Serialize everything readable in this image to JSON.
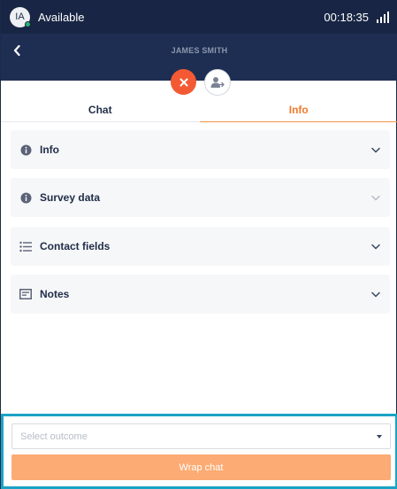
{
  "status_bar": {
    "avatar_initials": "IA",
    "presence_color": "#2ab36a",
    "status_label": "Available",
    "timer": "00:18:35"
  },
  "header": {
    "contact_name": "JAMES SMITH",
    "back_icon": "chevron-left-icon",
    "end_icon": "close-icon",
    "transfer_icon": "transfer-user-icon"
  },
  "tabs": [
    {
      "label": "Chat",
      "active": false
    },
    {
      "label": "Info",
      "active": true
    }
  ],
  "sections": [
    {
      "label": "Info",
      "icon": "info-circle-icon"
    },
    {
      "label": "Survey data",
      "icon": "info-circle-icon"
    },
    {
      "label": "Contact fields",
      "icon": "list-icon"
    },
    {
      "label": "Notes",
      "icon": "notes-icon"
    }
  ],
  "footer": {
    "outcome_placeholder": "Select outcome",
    "wrap_label": "Wrap chat"
  },
  "colors": {
    "header_bg": "#182544",
    "accent": "#ef7a2b",
    "end_button": "#f35a33",
    "wrap_button": "#fbab73",
    "focus_outline": "#1aa3c5"
  }
}
